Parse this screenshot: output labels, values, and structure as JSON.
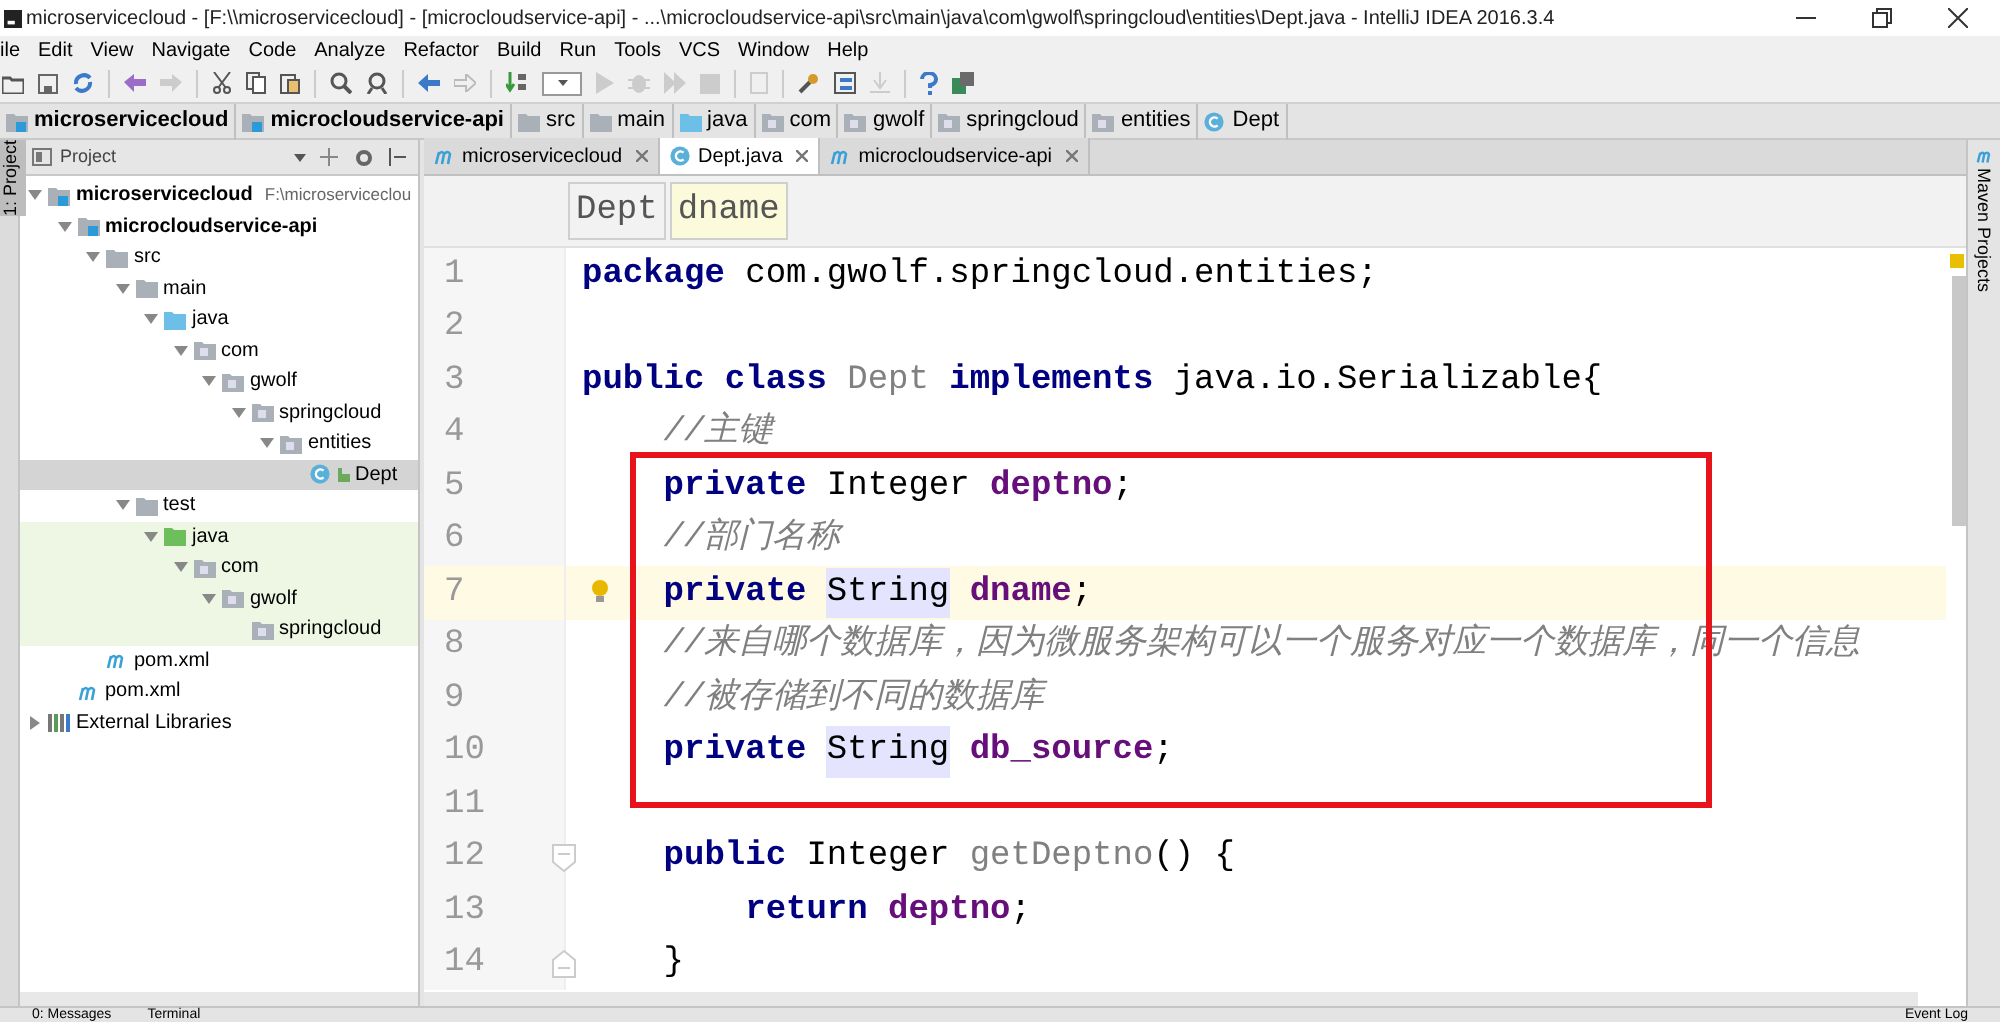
{
  "window": {
    "title": "microservicecloud - [F:\\\\microservicecloud] - [microcloudservice-api] - ...\\microcloudservice-api\\src\\main\\java\\com\\gwolf\\springcloud\\entities\\Dept.java - IntelliJ IDEA 2016.3.4"
  },
  "menu": [
    "ile",
    "Edit",
    "View",
    "Navigate",
    "Code",
    "Analyze",
    "Refactor",
    "Build",
    "Run",
    "Tools",
    "VCS",
    "Window",
    "Help"
  ],
  "navigation_bar": [
    {
      "label": "microservicecloud",
      "kind": "module"
    },
    {
      "label": "microcloudservice-api",
      "kind": "module"
    },
    {
      "label": "src",
      "kind": "folder"
    },
    {
      "label": "main",
      "kind": "folder"
    },
    {
      "label": "java",
      "kind": "source"
    },
    {
      "label": "com",
      "kind": "package"
    },
    {
      "label": "gwolf",
      "kind": "package"
    },
    {
      "label": "springcloud",
      "kind": "package"
    },
    {
      "label": "entities",
      "kind": "package"
    },
    {
      "label": "Dept",
      "kind": "class"
    }
  ],
  "left_strip": {
    "label": "1: Project"
  },
  "project_panel": {
    "title": "Project",
    "tree": [
      {
        "label": "microservicecloud",
        "kind": "module",
        "path": "F:\\microserviceclou",
        "expanded": true,
        "selected": false,
        "children": [
          {
            "label": "microcloudservice-api",
            "kind": "module",
            "expanded": true,
            "selected": false,
            "children": [
              {
                "label": "src",
                "kind": "folder",
                "expanded": true,
                "selected": false,
                "children": [
                  {
                    "label": "main",
                    "kind": "folder",
                    "expanded": true,
                    "selected": false,
                    "children": [
                      {
                        "label": "java",
                        "kind": "source",
                        "expanded": true,
                        "selected": false,
                        "children": [
                          {
                            "label": "com",
                            "kind": "package",
                            "expanded": true,
                            "selected": false,
                            "children": [
                              {
                                "label": "gwolf",
                                "kind": "package",
                                "expanded": true,
                                "selected": false,
                                "children": [
                                  {
                                    "label": "springcloud",
                                    "kind": "package",
                                    "expanded": true,
                                    "selected": false,
                                    "children": [
                                      {
                                        "label": "entities",
                                        "kind": "package",
                                        "expanded": true,
                                        "selected": false,
                                        "children": [
                                          {
                                            "label": "Dept",
                                            "kind": "class",
                                            "selected": true
                                          }
                                        ]
                                      }
                                    ]
                                  }
                                ]
                              }
                            ]
                          }
                        ]
                      }
                    ]
                  },
                  {
                    "label": "test",
                    "kind": "folder",
                    "expanded": true,
                    "selected": false,
                    "children": [
                      {
                        "label": "java",
                        "kind": "test-source",
                        "expanded": true,
                        "selected": false,
                        "children": [
                          {
                            "label": "com",
                            "kind": "package",
                            "expanded": true,
                            "selected": false,
                            "children": [
                              {
                                "label": "gwolf",
                                "kind": "package",
                                "expanded": true,
                                "selected": false,
                                "children": [
                                  {
                                    "label": "springcloud",
                                    "kind": "package",
                                    "selected": false
                                  }
                                ]
                              }
                            ]
                          }
                        ]
                      }
                    ]
                  }
                ]
              },
              {
                "label": "pom.xml",
                "kind": "maven",
                "selected": false
              }
            ]
          },
          {
            "label": "pom.xml",
            "kind": "maven",
            "selected": false
          }
        ]
      },
      {
        "label": "External Libraries",
        "kind": "libraries",
        "expanded": false,
        "selected": false
      }
    ]
  },
  "tabs": [
    {
      "label": "microservicecloud",
      "kind": "maven",
      "selected": false
    },
    {
      "label": "Dept.java",
      "kind": "class",
      "selected": true
    },
    {
      "label": "microcloudservice-api",
      "kind": "maven",
      "selected": false
    }
  ],
  "editor_breadcrumb": [
    {
      "label": "Dept",
      "selected": false
    },
    {
      "label": "dname",
      "selected": true
    }
  ],
  "code": [
    {
      "number": "1",
      "current": false,
      "intention": false,
      "fold_start": false,
      "fold_end": false,
      "tokens": [
        {
          "kind": "keyword",
          "text": "package"
        },
        {
          "kind": "plain",
          "text": " com.gwolf.springcloud.entities;"
        }
      ]
    },
    {
      "number": "2",
      "current": false,
      "intention": false,
      "fold_start": false,
      "fold_end": false
    },
    {
      "number": "3",
      "current": false,
      "intention": false,
      "fold_start": false,
      "fold_end": false,
      "tokens": [
        {
          "kind": "keyword",
          "text": "public class"
        },
        {
          "kind": "unused",
          "text": " Dept"
        },
        {
          "kind": "keyword",
          "text": " implements"
        },
        {
          "kind": "plain",
          "text": " java.io.Serializable{"
        }
      ]
    },
    {
      "number": "4",
      "current": false,
      "intention": false,
      "fold_start": false,
      "fold_end": false,
      "tokens": [
        {
          "kind": "comment",
          "text": "    //主键"
        }
      ]
    },
    {
      "number": "5",
      "current": false,
      "intention": false,
      "fold_start": false,
      "fold_end": false,
      "tokens": [
        {
          "kind": "keyword",
          "text": "    private"
        },
        {
          "kind": "plain",
          "text": " Integer "
        },
        {
          "kind": "field",
          "text": "deptno"
        },
        {
          "kind": "plain",
          "text": ";"
        }
      ]
    },
    {
      "number": "6",
      "current": false,
      "intention": false,
      "fold_start": false,
      "fold_end": false,
      "tokens": [
        {
          "kind": "comment",
          "text": "    //部门名称"
        }
      ]
    },
    {
      "number": "7",
      "current": true,
      "intention": true,
      "fold_start": false,
      "fold_end": false,
      "tokens": [
        {
          "kind": "keyword",
          "text": "    private "
        },
        {
          "kind": "usage",
          "text": "String"
        },
        {
          "kind": "field",
          "text": " dname"
        },
        {
          "kind": "plain",
          "text": ";"
        }
      ]
    },
    {
      "number": "8",
      "current": false,
      "intention": false,
      "fold_start": false,
      "fold_end": false,
      "tokens": [
        {
          "kind": "comment",
          "text": "    //来自哪个数据库，因为微服务架构可以一个服务对应一个数据库，同一个信息"
        }
      ]
    },
    {
      "number": "9",
      "current": false,
      "intention": false,
      "fold_start": false,
      "fold_end": false,
      "tokens": [
        {
          "kind": "comment",
          "text": "    //被存储到不同的数据库"
        }
      ]
    },
    {
      "number": "10",
      "current": false,
      "intention": false,
      "fold_start": false,
      "fold_end": false,
      "tokens": [
        {
          "kind": "keyword",
          "text": "    private "
        },
        {
          "kind": "usage",
          "text": "String"
        },
        {
          "kind": "field",
          "text": " db_source"
        },
        {
          "kind": "plain",
          "text": ";"
        }
      ]
    },
    {
      "number": "11",
      "current": false,
      "intention": false,
      "fold_start": false,
      "fold_end": false
    },
    {
      "number": "12",
      "current": false,
      "intention": false,
      "fold_start": true,
      "fold_end": false,
      "tokens": [
        {
          "kind": "keyword",
          "text": "    public"
        },
        {
          "kind": "plain",
          "text": " Integer "
        },
        {
          "kind": "unused",
          "text": "getDeptno"
        },
        {
          "kind": "plain",
          "text": "() {"
        }
      ]
    },
    {
      "number": "13",
      "current": false,
      "intention": false,
      "fold_start": false,
      "fold_end": false,
      "tokens": [
        {
          "kind": "keyword",
          "text": "        return"
        },
        {
          "kind": "field",
          "text": " deptno"
        },
        {
          "kind": "plain",
          "text": ";"
        }
      ]
    },
    {
      "number": "14",
      "current": false,
      "intention": false,
      "fold_start": false,
      "fold_end": true,
      "tokens": [
        {
          "kind": "plain",
          "text": "    }"
        }
      ]
    }
  ],
  "right_strip": {
    "label": "Maven Projects"
  },
  "status_bar": [
    "0: Messages",
    "Terminal",
    "Event Log"
  ]
}
